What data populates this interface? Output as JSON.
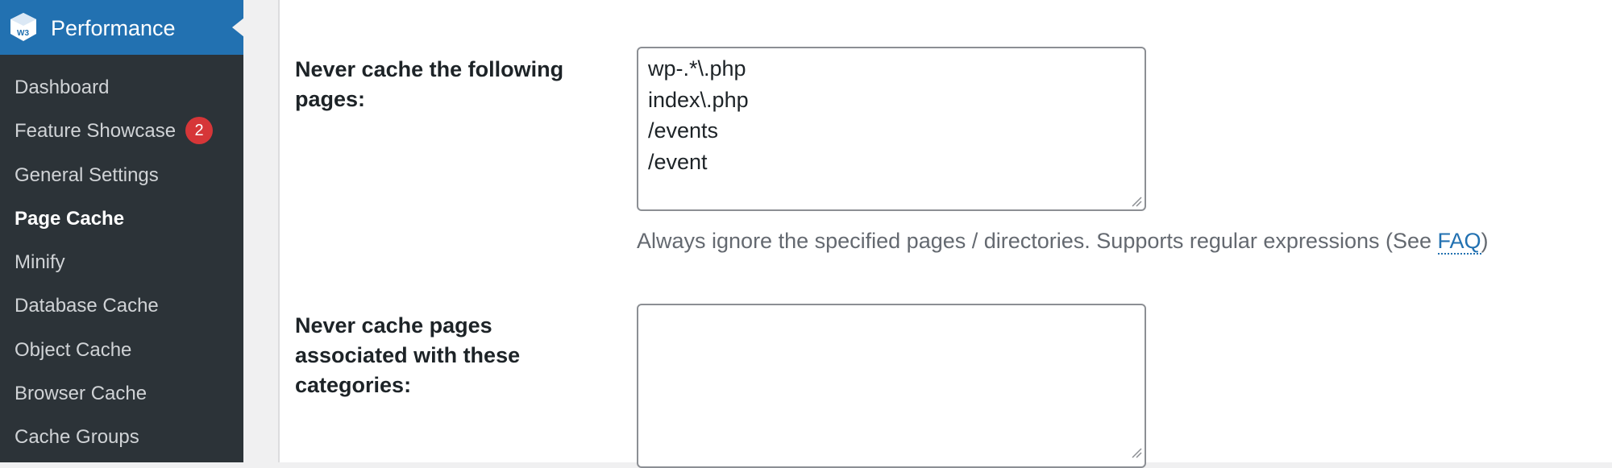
{
  "sidebar": {
    "header_title": "Performance",
    "logo_text": "W3",
    "items": [
      {
        "label": "Dashboard"
      },
      {
        "label": "Feature Showcase",
        "badge": "2"
      },
      {
        "label": "General Settings"
      },
      {
        "label": "Page Cache",
        "current": true
      },
      {
        "label": "Minify"
      },
      {
        "label": "Database Cache"
      },
      {
        "label": "Object Cache"
      },
      {
        "label": "Browser Cache"
      },
      {
        "label": "Cache Groups"
      }
    ]
  },
  "form": {
    "reject_uri": {
      "label_line1": "Never cache the following",
      "label_line2": "pages:",
      "lines": [
        "wp-.*\\.php",
        "index\\.php",
        "/events",
        "/event"
      ],
      "description_prefix": "Always ignore the specified pages / directories. Supports regular expressions (See ",
      "faq_link": "FAQ",
      "description_suffix": ")"
    },
    "reject_categories": {
      "label_line1": "Never cache pages",
      "label_line2": "associated with these",
      "label_line3": "categories:",
      "value": ""
    }
  },
  "colors": {
    "sidebar_bg": "#2c3338",
    "header_bg": "#2271b1",
    "badge_bg": "#d63638",
    "link": "#2271b1"
  }
}
